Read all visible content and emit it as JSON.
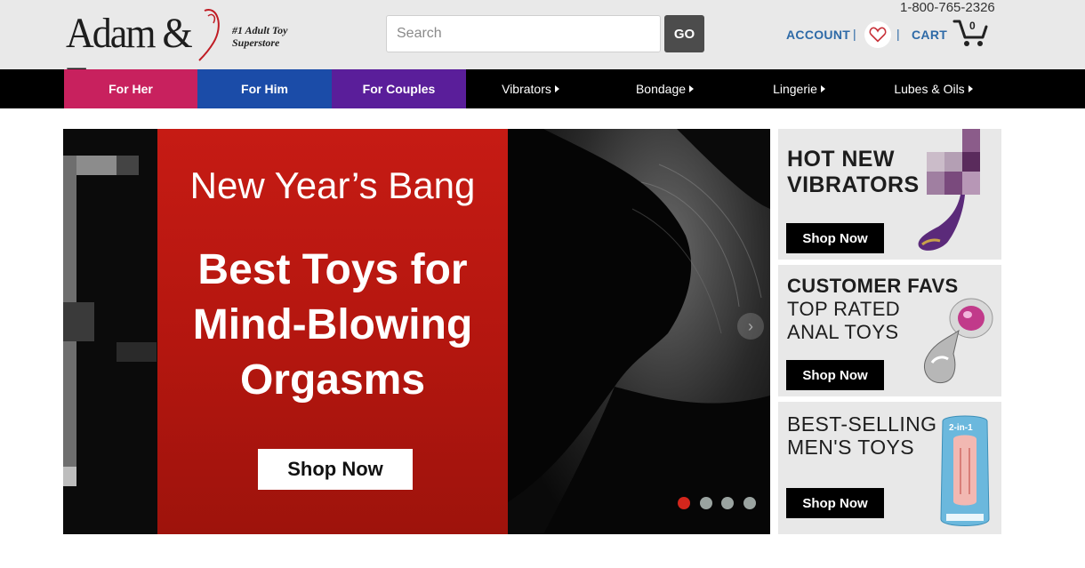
{
  "header": {
    "brand": "Adam & Eve",
    "tagline_line1": "#1 Adult Toy",
    "tagline_line2": "Superstore",
    "search_placeholder": "Search",
    "search_button": "GO",
    "phone": "1-800-765-2326",
    "account_label": "ACCOUNT",
    "separator": "|",
    "cart_label": "CART",
    "cart_count": "0"
  },
  "nav": {
    "items": [
      {
        "label": "For Her"
      },
      {
        "label": "For Him"
      },
      {
        "label": "For Couples"
      },
      {
        "label": "Vibrators"
      },
      {
        "label": "Bondage"
      },
      {
        "label": "Lingerie"
      },
      {
        "label": "Lubes & Oils"
      }
    ]
  },
  "hero": {
    "headline": "New Year’s Bang",
    "title_line1": "Best Toys for",
    "title_line2": "Mind-Blowing",
    "title_line3": "Orgasms",
    "cta": "Shop Now",
    "slide_count": 4,
    "active_slide": 1
  },
  "promos": [
    {
      "line1": "HOT NEW",
      "line2": "VIBRATORS",
      "cta": "Shop Now"
    },
    {
      "line1": "CUSTOMER FAVS",
      "line2": "TOP RATED",
      "line3": "ANAL TOYS",
      "cta": "Shop Now"
    },
    {
      "line1": "BEST-SELLING",
      "line2": "MEN'S TOYS",
      "product_label": "2-in-1",
      "cta": "Shop Now"
    }
  ],
  "colors": {
    "for_her": "#c8215e",
    "for_him": "#1b4ca8",
    "for_couples": "#5a1e9a",
    "link_blue": "#2e6aa7",
    "hero_red": "#c61b14"
  }
}
